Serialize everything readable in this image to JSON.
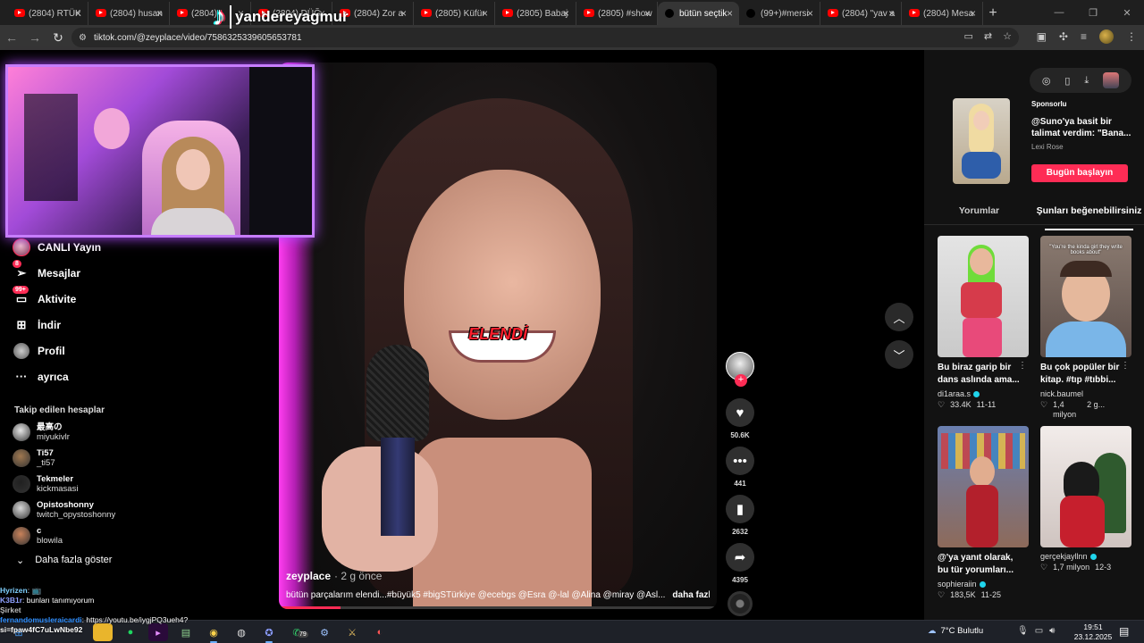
{
  "browser": {
    "tabs": [
      {
        "label": "(2804) RTÜK",
        "type": "yt"
      },
      {
        "label": "(2804) husan",
        "type": "yt"
      },
      {
        "label": "(2804)",
        "type": "yt"
      },
      {
        "label": "(2804) DÜĞ",
        "type": "yt"
      },
      {
        "label": "(2804) Zor a",
        "type": "yt"
      },
      {
        "label": "(2805) Küfür",
        "type": "yt"
      },
      {
        "label": "(2805) Babaj",
        "type": "yt"
      },
      {
        "label": "(2805) #show",
        "type": "yt"
      },
      {
        "label": "bütün seçtik",
        "type": "tt",
        "active": true
      },
      {
        "label": "(99+)#mersi",
        "type": "tt"
      },
      {
        "label": "(2804) \"yav a",
        "type": "yt"
      },
      {
        "label": "(2804) Mesa",
        "type": "yt"
      }
    ],
    "url": "tiktok.com/@zeyplace/video/7586325339605653781"
  },
  "stream_overlay": {
    "name": "yandereyagmur"
  },
  "sidebar": {
    "nav": [
      {
        "label": "CANLI Yayın",
        "icon": "live-avatar-icon"
      },
      {
        "label": "Mesajlar",
        "icon": "paper-plane-icon",
        "badge": "8"
      },
      {
        "label": "Aktivite",
        "icon": "activity-icon",
        "badge": "99+"
      },
      {
        "label": "İndir",
        "icon": "download-plus-icon"
      },
      {
        "label": "Profil",
        "icon": "profile-avatar-icon"
      },
      {
        "label": "ayrıca",
        "icon": "more-dots-icon"
      }
    ],
    "following_header": "Takip edilen hesaplar",
    "following": [
      {
        "name": "最高の",
        "handle": "miyukivlr",
        "color": "#e6e6e6"
      },
      {
        "name": "Ti57",
        "handle": "_ti57",
        "color": "#a07850"
      },
      {
        "name": "Tekmeler",
        "handle": "kickmasasi",
        "color": "#202020"
      },
      {
        "name": "Opistoshonny",
        "handle": "twitch_opystoshonny",
        "color": "#d8d8d8"
      },
      {
        "name": "ϲ",
        "handle": "blowila",
        "color": "#c9825a"
      }
    ],
    "show_more": "Daha fazla göster"
  },
  "video": {
    "caption": "ELENDİ",
    "author": "zeyplace",
    "time": "· 2 g önce",
    "description": "bütün parçalarım elendi...#büyük5 #bigSTürkiye @ecebgs @Esra @-lal @Alina @miray @Asl...",
    "more": "daha fazlası",
    "progress": 0.14
  },
  "actions": {
    "likes": "50.6K",
    "comments": "441",
    "saves": "2632",
    "shares": "4395"
  },
  "right_panel": {
    "ad": {
      "sponsored": "Sponsorlu",
      "title": "@Suno'ya basit bir talimat verdim: \"Bana...",
      "author": "Lexi Rose",
      "cta": "Bugün başlayın"
    },
    "tabs": [
      "Yorumlar",
      "Şunları beğenebilirsiniz"
    ],
    "cards": [
      {
        "title": "Bu biraz garip bir dans aslında ama...",
        "author": "di1araa.s",
        "verified": true,
        "likes": "33.4K",
        "date": "11-11"
      },
      {
        "title": "Bu çok popüler bir kitap. #tıp #tıbbi...",
        "author": "nick.baumel",
        "verified": false,
        "likes": "1,4 milyon",
        "date": "2 g...",
        "overlay": "\"You're the kinda girl they write books about\""
      },
      {
        "title": "@'ya yanıt olarak, bu tür yorumları...",
        "author": "sophieraiin",
        "verified": true,
        "likes": "183,5K",
        "date": "11-25"
      },
      {
        "title": "",
        "author": "gerçekjayllnn",
        "verified": true,
        "likes": "1,7 milyon",
        "date": "12-3"
      }
    ]
  },
  "chat": [
    {
      "user": "Hyrizen",
      "text": ": 📺",
      "color": "#7fd1ff"
    },
    {
      "user": "K3B1r",
      "text": ": bunları tanımıyorum",
      "color": "#8fa0ff"
    },
    {
      "user": "Şirket",
      "text": "",
      "color": "#bbbbbb"
    },
    {
      "user": "fernandomusleraicardi",
      "text": ": https://youtu.be/iygjPQ3ueh4?",
      "color": "#2f8fff"
    },
    {
      "user": "si=fpaw4fC7uLwNbe92",
      "text": "",
      "color": "#ffffff"
    }
  ],
  "taskbar": {
    "weather": "7°C  Bulutlu",
    "time": "19:51",
    "date": "23.12.2025",
    "whatsapp_badge": "79"
  }
}
